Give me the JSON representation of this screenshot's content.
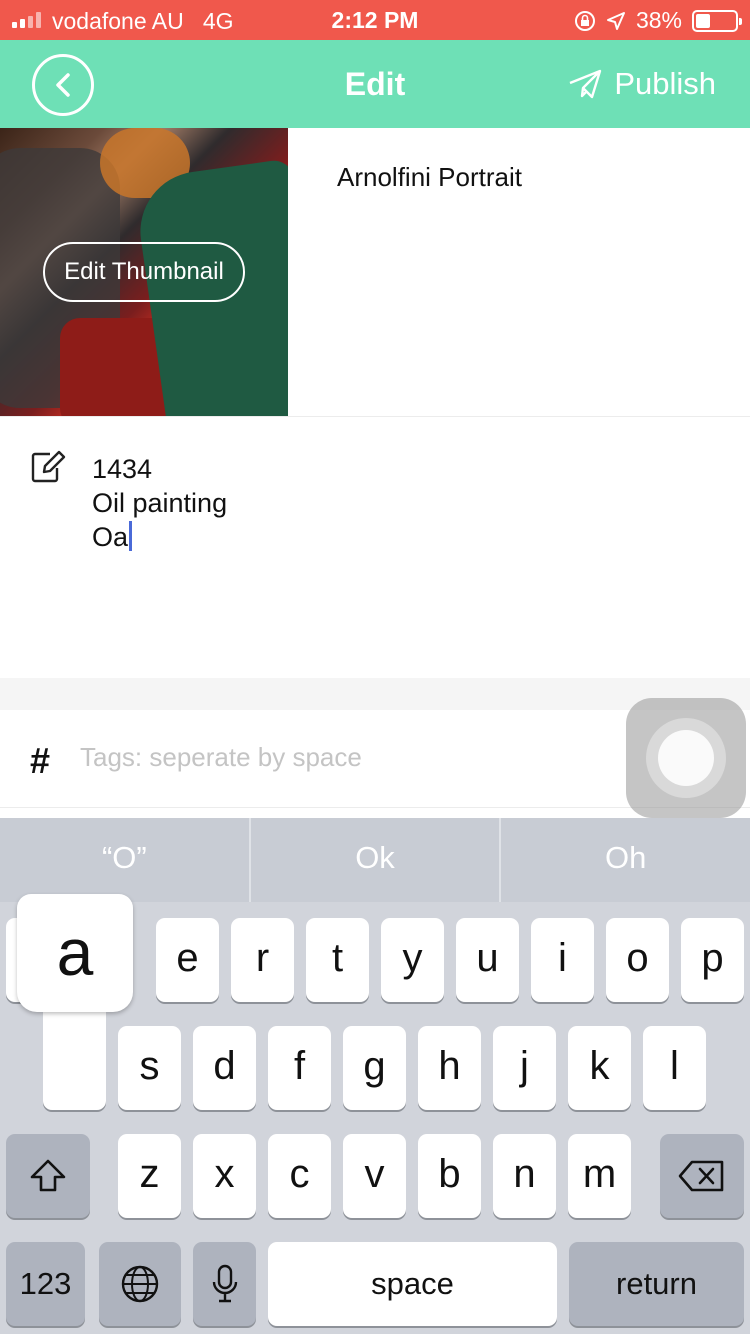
{
  "status_bar": {
    "carrier": "vodafone AU",
    "network": "4G",
    "time": "2:12 PM",
    "battery": "38%",
    "battery_level": 0.38
  },
  "nav": {
    "title": "Edit",
    "publish_label": "Publish"
  },
  "artwork": {
    "edit_thumbnail_label": "Edit Thumbnail",
    "title": "Arnolfini Portrait"
  },
  "description": {
    "lines": [
      "1434",
      "Oil painting",
      "Oa"
    ]
  },
  "tags": {
    "placeholder": "Tags: seperate by space",
    "icon": "#"
  },
  "keyboard": {
    "suggestions": [
      "“O”",
      "Ok",
      "Oh"
    ],
    "popup_key": "a",
    "row1": [
      "e",
      "r",
      "t",
      "y",
      "u",
      "i",
      "o",
      "p"
    ],
    "row2": [
      "s",
      "d",
      "f",
      "g",
      "h",
      "j",
      "k",
      "l"
    ],
    "row3": [
      "z",
      "x",
      "c",
      "v",
      "b",
      "n",
      "m"
    ],
    "numbers_label": "123",
    "space_label": "space",
    "return_label": "return"
  },
  "colors": {
    "status_bar": "#f0584c",
    "nav_bar": "#6ee0b6",
    "cursor": "#4a6ad8"
  }
}
